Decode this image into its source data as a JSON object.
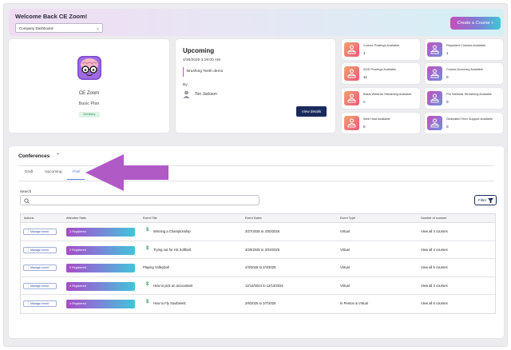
{
  "header": {
    "welcome": "Welcome Back CE Zoom!",
    "dashboard_select": "Company Dashboard",
    "create_course": "Create a Course +"
  },
  "profile": {
    "name": "CE Zoom",
    "plan": "Basic Plan",
    "role": "Dentistry"
  },
  "upcoming": {
    "title": "Upcoming",
    "date": "4/30/2025 3:19:00 AM",
    "event": "Brushing Teeth demo",
    "by_label": "By:",
    "user": "Tori Jackson",
    "view_details": "View details"
  },
  "stats": [
    {
      "label": "Course Postings Available",
      "value": "1",
      "color": "orange"
    },
    {
      "label": "Repeated Courses Available",
      "value": "1",
      "color": "purple"
    },
    {
      "label": "AGD Postings Available",
      "value": "11",
      "color": "orange"
    },
    {
      "label": "Course Accuracy Available",
      "value": "0",
      "color": "purple"
    },
    {
      "label": "Basic Webinar Streaming Available",
      "value": "0",
      "color": "orange"
    },
    {
      "label": "Pro Webinar Streaming Available",
      "value": "0",
      "color": "purple"
    },
    {
      "label": "Web Host Available",
      "value": "0",
      "color": "orange"
    },
    {
      "label": "Dedicated Tech Support Available",
      "value": "0",
      "color": "purple"
    }
  ],
  "conferences": {
    "title": "Conferences",
    "tabs": [
      "Draft",
      "Upcoming",
      "Past"
    ],
    "active_tab": "Past",
    "search_label": "Search",
    "search_placeholder": "",
    "filter_label": "Filter",
    "columns": [
      "Actions",
      "Attendee Stats",
      "Event Title",
      "Event Dates",
      "Event Type",
      "Number of courses"
    ],
    "rows": [
      {
        "action": "Manage event",
        "registered": "3 Registered",
        "title": "Winning a Championship",
        "paid": true,
        "dates": "3/27/2025 to 3/30/2025",
        "type": "Virtual",
        "courses": "View all 4 courses"
      },
      {
        "action": "Manage event",
        "registered": "2 Registered",
        "title": "Trying out for HS Softball",
        "paid": true,
        "dates": "3/20/2025 to 3/23/2025",
        "type": "Virtual",
        "courses": "View all 4 courses"
      },
      {
        "action": "Manage event",
        "registered": "0 Registered",
        "title": "Playing Volleyball",
        "paid": false,
        "dates": "2/3/2025 to 2/4/2025",
        "type": "Virtual",
        "courses": "View all 5 courses"
      },
      {
        "action": "Manage event",
        "registered": "4 Registered",
        "title": "How to pick an accountant",
        "paid": true,
        "dates": "12/13/2024 to 12/13/2024",
        "type": "Virtual",
        "courses": "View all 3 courses"
      },
      {
        "action": "Manage event",
        "registered": "4 Registered",
        "title": "How to Fly Southwest",
        "paid": true,
        "dates": "2/6/2025 to 3/7/2025",
        "type": "In Person & Virtual",
        "courses": "View all 6 courses"
      }
    ]
  }
}
